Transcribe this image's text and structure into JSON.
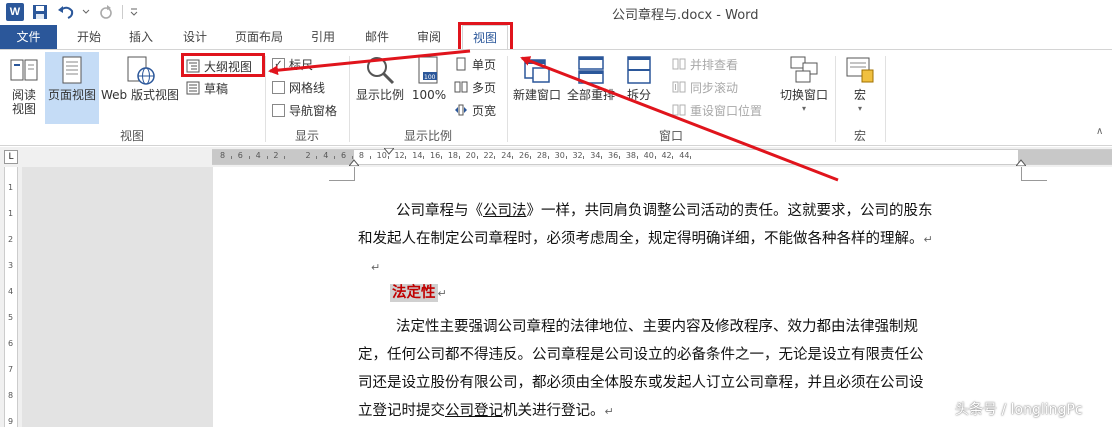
{
  "window": {
    "title": "公司章程与.docx - Word"
  },
  "qat": {
    "app_icon": "word-app-icon",
    "logo_letter": "W"
  },
  "tabs": [
    {
      "label": "文件"
    },
    {
      "label": "开始"
    },
    {
      "label": "插入"
    },
    {
      "label": "设计"
    },
    {
      "label": "页面布局"
    },
    {
      "label": "引用"
    },
    {
      "label": "邮件"
    },
    {
      "label": "审阅"
    },
    {
      "label": "视图"
    }
  ],
  "ribbon": {
    "groups": {
      "views": "视图",
      "show": "显示",
      "zoom": "显示比例",
      "window": "窗口",
      "macros": "宏"
    },
    "views": {
      "read_mode_line1": "阅读",
      "read_mode_line2": "视图",
      "print_layout": "页面视图",
      "web_layout": "Web 版式视图",
      "outline": "大纲视图",
      "draft": "草稿"
    },
    "show": {
      "ruler": "标尺",
      "gridlines": "网格线",
      "nav_pane": "导航窗格"
    },
    "zoom": {
      "zoom": "显示比例",
      "hundred": "100%",
      "one_page": "单页",
      "multi_page": "多页",
      "page_width": "页宽"
    },
    "window": {
      "new_window": "新建窗口",
      "arrange_all": "全部重排",
      "split": "拆分",
      "side_by_side": "并排查看",
      "sync_scroll": "同步滚动",
      "reset_pos": "重设窗口位置",
      "switch": "切换窗口"
    },
    "macros": {
      "macro": "宏"
    }
  },
  "ruler": {
    "corner": "L",
    "labels": [
      "8",
      "6",
      "4",
      "2",
      "2",
      "4",
      "6",
      "8",
      "10",
      "12",
      "14",
      "16",
      "18",
      "20",
      "22",
      "24",
      "26",
      "28",
      "30",
      "32",
      "34",
      "36",
      "38",
      "40",
      "42",
      "44"
    ]
  },
  "vruler": {
    "labels": [
      "1",
      "1",
      "2",
      "3",
      "4",
      "5",
      "6",
      "7",
      "8",
      "9"
    ]
  },
  "document": {
    "para1_a": "公司章程与《",
    "para1_link": "公司法",
    "para1_b": "》一样，共同肩负调整公司活动的责任。这就要求，公司的股东",
    "para1_line2": "和发起人在制定公司章程时，必须考虑周全，规定得明确详细，不能做各种各样的理解。",
    "para_mark": "↵",
    "heading": "法定性",
    "para2_line1": "法定性主要强调公司章程的法律地位、主要内容及修改程序、效力都由法律强制规",
    "para2_line2": "定，任何公司都不得违反。公司章程是公司设立的必备条件之一，无论是设立有限责任公",
    "para2_line3": "司还是设立股份有限公司，都必须由全体股东或发起人订立公司章程，并且必须在公司设",
    "para2_line4a": "立登记时提交",
    "para2_line4_link": "公司登记",
    "para2_line4b": "机关进行登记。"
  },
  "watermark": "头条号 / longlingPc",
  "colors": {
    "accent": "#2b579a",
    "highlight_box": "#e0141c",
    "heading": "#c00000"
  }
}
